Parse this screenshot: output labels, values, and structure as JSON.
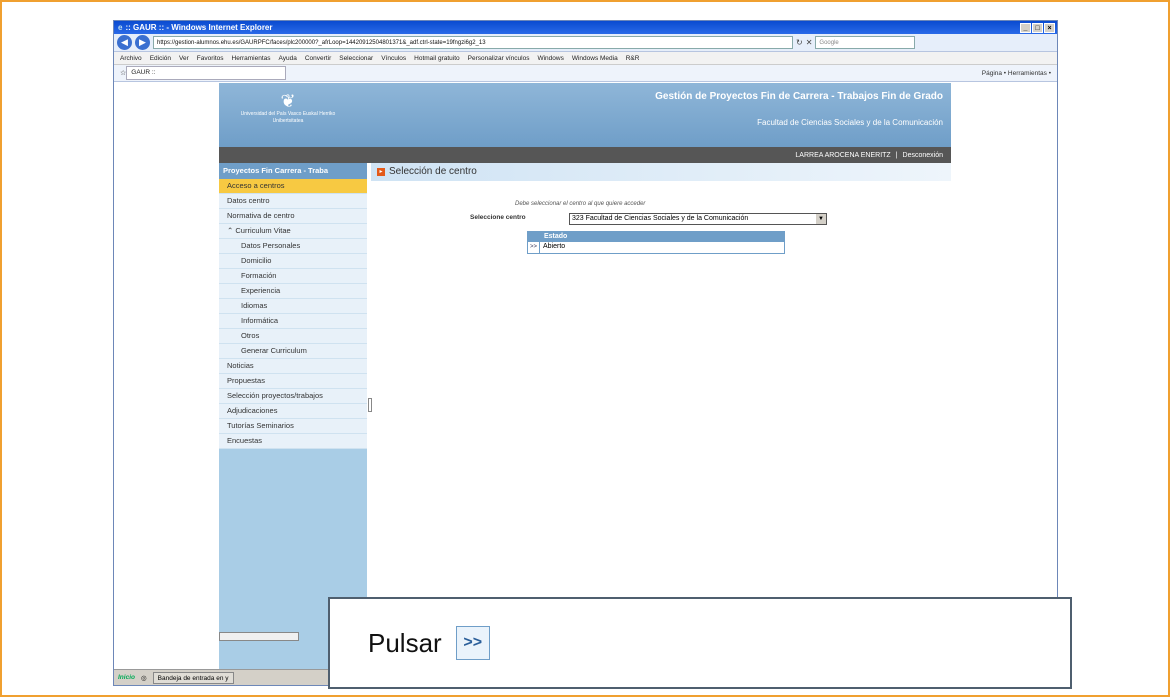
{
  "window": {
    "title": ":: GAUR :: - Windows Internet Explorer",
    "address": "https://gestion-alumnos.ehu.es/GAURPFC/faces/plc200000?_afrLoop=14420912504801371&_adf.ctrl-state=19fngzi6g2_13",
    "search_placeholder": "Google",
    "menu": [
      "Archivo",
      "Edición",
      "Ver",
      "Favoritos",
      "Herramientas",
      "Ayuda"
    ],
    "toolbar": [
      "Convertir",
      "Seleccionar",
      "Vínculos",
      "Hotmail gratuito",
      "Personalizar vínculos",
      "Windows",
      "Windows Media",
      "R&R"
    ],
    "tab": "GAUR ::",
    "tools": "Página • Herramientas •"
  },
  "banner": {
    "logo_text": "Universidad del País Vasco  Euskal Herriko Unibertsitatea",
    "title": "Gestión de Proyectos Fin de Carrera - Trabajos Fin de Grado",
    "subtitle": "Facultad de Ciencias Sociales y de la Comunicación"
  },
  "userbar": {
    "user": "LARREA AROCENA ENERITZ",
    "separator": "|",
    "logout": "Desconexión"
  },
  "sidebar": {
    "header": "Proyectos Fin Carrera - Traba",
    "items": [
      "Acceso a centros",
      "Datos centro",
      "Normativa de centro",
      "Curriculum Vitae"
    ],
    "subitems": [
      "Datos Personales",
      "Domicilio",
      "Formación",
      "Experiencia",
      "Idiomas",
      "Informática",
      "Otros",
      "Generar Curriculum"
    ],
    "items2": [
      "Noticias",
      "Propuestas",
      "Selección proyectos/trabajos",
      "Adjudicaciones",
      "Tutorías Seminarios",
      "Encuestas"
    ]
  },
  "main": {
    "title": "Selección de centro",
    "instruction": "Debe seleccionar el centro al que quiere acceder",
    "select_label": "Seleccione centro",
    "select_value": "323 Facultad de Ciencias Sociales y de la Comunicación",
    "table_header": "Estado",
    "row_button": ">>",
    "row_value": "Abierto"
  },
  "statusbar": {
    "start": "Inicio",
    "task": "Bandeja de entrada en y"
  },
  "callout": {
    "text": "Pulsar",
    "icon": ">>"
  }
}
